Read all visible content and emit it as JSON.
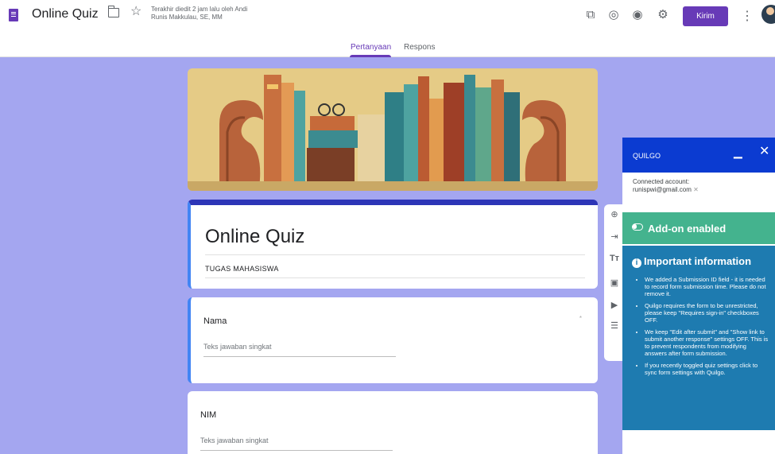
{
  "header": {
    "title": "Online Quiz",
    "saved_status": "Terakhir diedit 2 jam lalu oleh Andi Runis Makkulau, SE, MM",
    "send_label": "Kirim"
  },
  "tabs": [
    {
      "label": "Pertanyaan",
      "active": true
    },
    {
      "label": "Respons",
      "active": false
    }
  ],
  "form": {
    "title": "Online Quiz",
    "description": "TUGAS MAHASISWA",
    "questions": [
      {
        "label": "Nama",
        "placeholder": "Teks jawaban singkat"
      },
      {
        "label": "NIM",
        "placeholder": "Teks jawaban singkat"
      }
    ]
  },
  "side_toolbar": {
    "text_icon": "Tт"
  },
  "addon": {
    "name": "QUILGO",
    "connected_label": "Connected account:",
    "connected_email": "runispwi@gmail.com",
    "enabled_text": "Add-on enabled",
    "info_title": "Important information",
    "info_items": [
      "We added a Submission ID field - it is needed to record form submission time. Please do not remove it.",
      "Quilgo requires the form to be unrestricted, please keep \"Requires sign-in\" checkboxes OFF.",
      "We keep \"Edit after submit\" and \"Show link to submit another response\" settings OFF. This is to prevent respondents from modifying answers after form submission.",
      "If you recently toggled quiz settings click to sync form settings with Quilgo."
    ]
  },
  "colors": {
    "accent": "#673ab7",
    "background": "#a4a6f0",
    "addon_header": "#0b3bd1",
    "enabled": "#44b38e",
    "info": "#1e7bb0"
  }
}
